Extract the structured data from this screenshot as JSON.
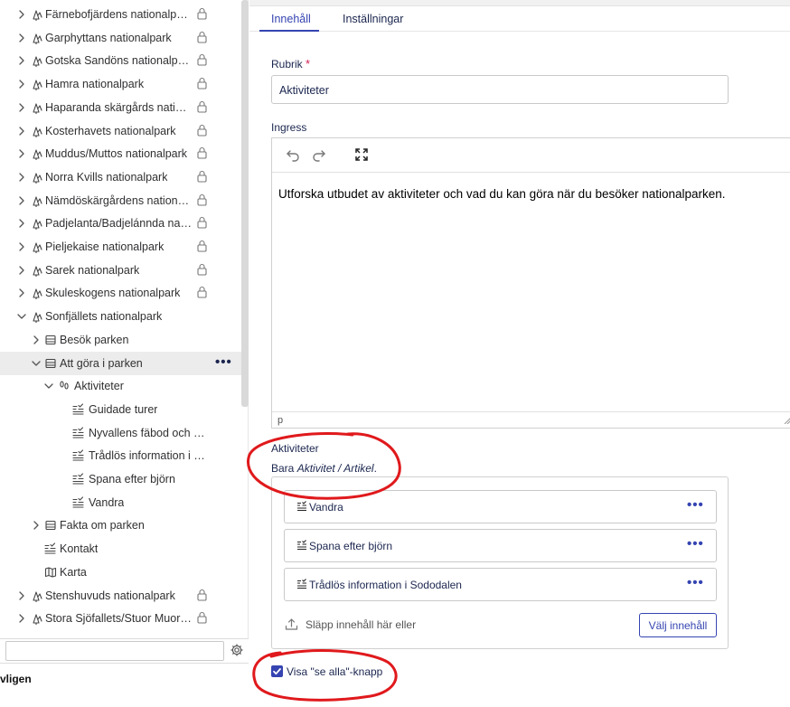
{
  "tree": {
    "items": [
      {
        "label": "Färnebofjärdens nationalpark",
        "level": 0,
        "icon": "tree-icon",
        "expander": "right",
        "lock": true
      },
      {
        "label": "Garphyttans nationalpark",
        "level": 0,
        "icon": "tree-icon",
        "expander": "right",
        "lock": true
      },
      {
        "label": "Gotska Sandöns nationalpark",
        "level": 0,
        "icon": "tree-icon",
        "expander": "right",
        "lock": true
      },
      {
        "label": "Hamra nationalpark",
        "level": 0,
        "icon": "tree-icon",
        "expander": "right",
        "lock": true
      },
      {
        "label": "Haparanda skärgårds nation...",
        "level": 0,
        "icon": "tree-icon",
        "expander": "right",
        "lock": true
      },
      {
        "label": "Kosterhavets nationalpark",
        "level": 0,
        "icon": "tree-icon",
        "expander": "right",
        "lock": true
      },
      {
        "label": "Muddus/Muttos nationalpark",
        "level": 0,
        "icon": "tree-icon",
        "expander": "right",
        "lock": true
      },
      {
        "label": "Norra Kvills nationalpark",
        "level": 0,
        "icon": "tree-icon",
        "expander": "right",
        "lock": true
      },
      {
        "label": "Nämdöskärgårdens national...",
        "level": 0,
        "icon": "tree-icon",
        "expander": "right",
        "lock": true
      },
      {
        "label": "Padjelanta/Badjelánnda nati...",
        "level": 0,
        "icon": "tree-icon",
        "expander": "right",
        "lock": true
      },
      {
        "label": "Pieljekaise nationalpark",
        "level": 0,
        "icon": "tree-icon",
        "expander": "right",
        "lock": true
      },
      {
        "label": "Sarek nationalpark",
        "level": 0,
        "icon": "tree-icon",
        "expander": "right",
        "lock": true
      },
      {
        "label": "Skuleskogens nationalpark",
        "level": 0,
        "icon": "tree-icon",
        "expander": "right",
        "lock": true
      },
      {
        "label": "Sonfjällets nationalpark",
        "level": 0,
        "icon": "tree-icon",
        "expander": "down",
        "lock": false
      },
      {
        "label": "Besök parken",
        "level": 1,
        "icon": "section-icon",
        "expander": "right",
        "lock": false
      },
      {
        "label": "Att göra i parken",
        "level": 1,
        "icon": "section-icon",
        "expander": "down",
        "lock": false,
        "active": true,
        "more": "•••"
      },
      {
        "label": "Aktiviteter",
        "level": 2,
        "icon": "footprints-icon",
        "expander": "down",
        "lock": false
      },
      {
        "label": "Guidade turer",
        "level": 3,
        "icon": "article-icon",
        "expander": "none",
        "lock": false
      },
      {
        "label": "Nyvallens fäbod och S...",
        "level": 3,
        "icon": "article-icon",
        "expander": "none",
        "lock": false
      },
      {
        "label": "Trådlös information i S...",
        "level": 3,
        "icon": "article-icon",
        "expander": "none",
        "lock": false
      },
      {
        "label": "Spana efter björn",
        "level": 3,
        "icon": "article-icon",
        "expander": "none",
        "lock": false
      },
      {
        "label": "Vandra",
        "level": 3,
        "icon": "article-icon",
        "expander": "none",
        "lock": false
      },
      {
        "label": "Fakta om parken",
        "level": 1,
        "icon": "section-icon",
        "expander": "right",
        "lock": false
      },
      {
        "label": "Kontakt",
        "level": 1,
        "icon": "article-icon",
        "expander": "none",
        "lock": false
      },
      {
        "label": "Karta",
        "level": 1,
        "icon": "map-icon",
        "expander": "none",
        "lock": false
      },
      {
        "label": "Stenshuvuds nationalpark",
        "level": 0,
        "icon": "tree-icon",
        "expander": "right",
        "lock": true
      },
      {
        "label": "Stora Sjöfallets/Stuor Muork...",
        "level": 0,
        "icon": "tree-icon",
        "expander": "right",
        "lock": true
      }
    ],
    "bottom_text": "vligen"
  },
  "tabs": [
    {
      "label": "Innehåll",
      "active": true
    },
    {
      "label": "Inställningar",
      "active": false
    }
  ],
  "form": {
    "rubrik_label": "Rubrik",
    "required_mark": "*",
    "rubrik_value": "Aktiviteter",
    "ingress_label": "Ingress",
    "ingress_text": "Utforska utbudet av aktiviteter och vad du kan göra när du besöker nationalparken.",
    "editor_status": "p",
    "aktiviteter_label": "Aktiviteter",
    "aktiviteter_desc_prefix": "Bara ",
    "aktiviteter_desc_types": "Aktivitet / Artikel",
    "aktiviteter_desc_suffix": ".",
    "cards": [
      {
        "label": "Vandra",
        "more": "•••"
      },
      {
        "label": "Spana efter björn",
        "more": "•••"
      },
      {
        "label": "Trådlös information i Sododalen",
        "more": "•••"
      }
    ],
    "drop_text": "Släpp innehåll här eller",
    "choose_button": "Välj innehåll",
    "see_all_label": "Visa \"se alla\"-knapp",
    "see_all_checked": true
  },
  "colors": {
    "accent": "#3544b1",
    "required": "#d42054",
    "annotation": "#e0191c",
    "active_row": "#ececec"
  }
}
